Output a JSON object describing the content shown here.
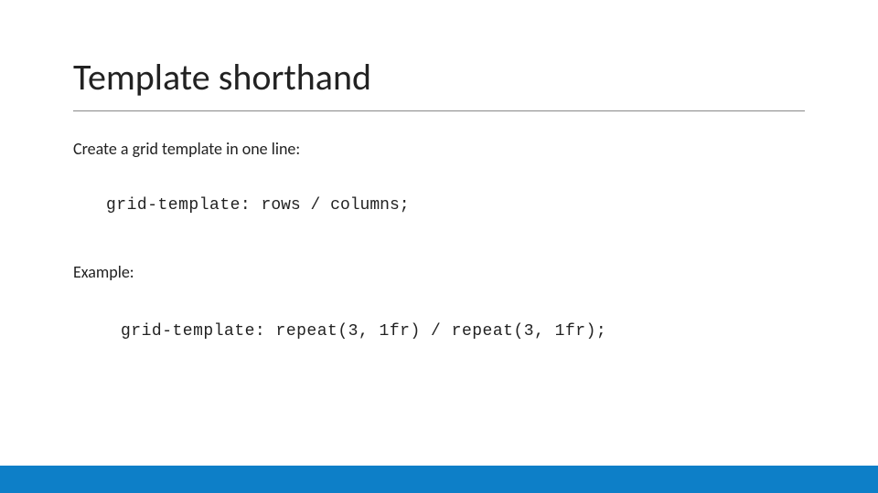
{
  "title": "Template shorthand",
  "intro": "Create a grid template in one line:",
  "syntax_property": "grid-template: ",
  "syntax_values": "rows / columns;",
  "example_label": "Example:",
  "example_code": "grid-template: repeat(3, 1fr) / repeat(3, 1fr);",
  "footer_color": "#0d7fc8"
}
